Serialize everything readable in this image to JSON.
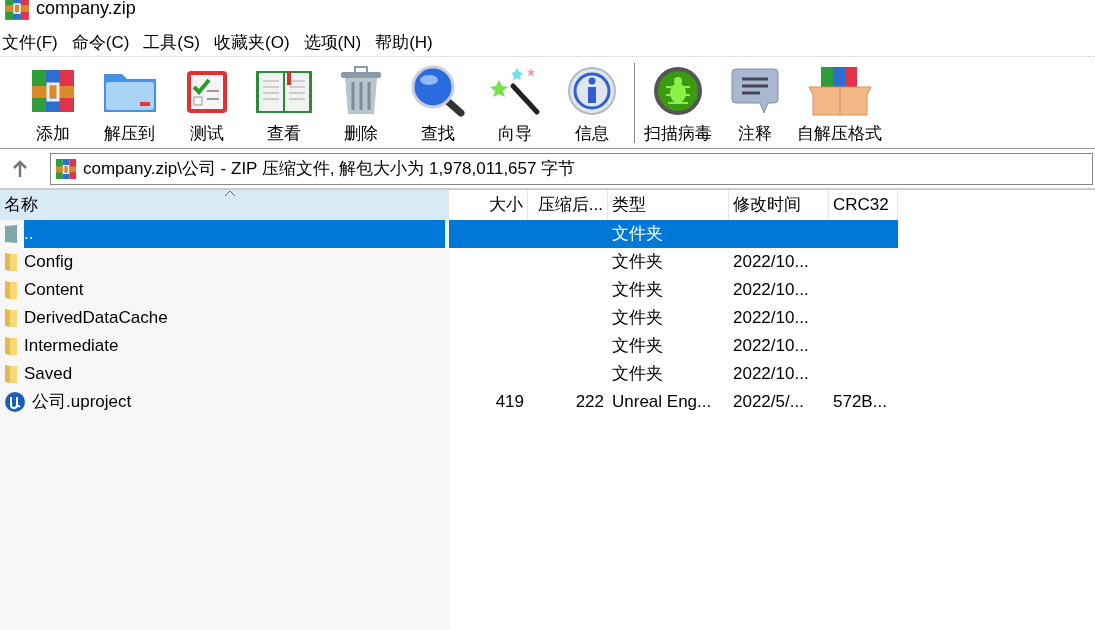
{
  "window": {
    "title": "company.zip"
  },
  "menu": [
    "文件(F)",
    "命令(C)",
    "工具(S)",
    "收藏夹(O)",
    "选项(N)",
    "帮助(H)"
  ],
  "toolbar": {
    "groups": [
      {
        "buttons": [
          "添加",
          "解压到",
          "测试",
          "查看",
          "删除",
          "查找",
          "向导",
          "信息"
        ]
      },
      {
        "buttons": [
          "扫描病毒",
          "注释",
          "自解压格式"
        ]
      }
    ]
  },
  "address": {
    "path": "company.zip\\公司 - ZIP 压缩文件, 解包大小为 1,978,011,657 字节"
  },
  "table": {
    "columns": [
      {
        "label": "名称",
        "sorted": true
      },
      {
        "label": "大小",
        "sorted": false
      },
      {
        "label": "压缩后...",
        "sorted": false
      },
      {
        "label": "类型",
        "sorted": false
      },
      {
        "label": "修改时间",
        "sorted": false
      },
      {
        "label": "CRC32",
        "sorted": false
      }
    ],
    "rows": [
      {
        "kind": "parent",
        "selected": true,
        "cells": [
          "..",
          "",
          "",
          "文件夹",
          "",
          ""
        ]
      },
      {
        "kind": "folder",
        "selected": false,
        "cells": [
          "Config",
          "",
          "",
          "文件夹",
          "2022/10...",
          ""
        ]
      },
      {
        "kind": "folder",
        "selected": false,
        "cells": [
          "Content",
          "",
          "",
          "文件夹",
          "2022/10...",
          ""
        ]
      },
      {
        "kind": "folder",
        "selected": false,
        "cells": [
          "DerivedDataCache",
          "",
          "",
          "文件夹",
          "2022/10...",
          ""
        ]
      },
      {
        "kind": "folder",
        "selected": false,
        "cells": [
          "Intermediate",
          "",
          "",
          "文件夹",
          "2022/10...",
          ""
        ]
      },
      {
        "kind": "folder",
        "selected": false,
        "cells": [
          "Saved",
          "",
          "",
          "文件夹",
          "2022/10...",
          ""
        ]
      },
      {
        "kind": "file",
        "selected": false,
        "cells": [
          "公司.uproject",
          "419",
          "222",
          "Unreal Eng...",
          "2022/5/...",
          "572B..."
        ]
      }
    ]
  }
}
